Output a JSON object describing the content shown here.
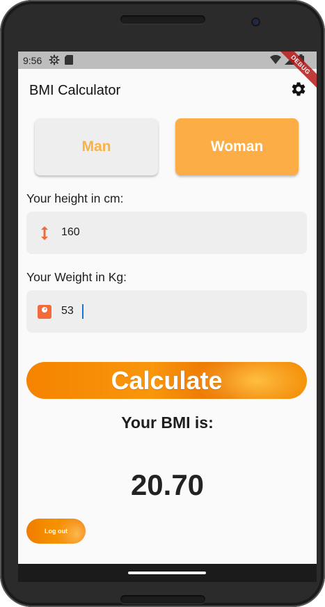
{
  "status_bar": {
    "time": "9:56",
    "debug_label": "DEBUG",
    "icons_left": [
      "settings-gear-icon",
      "sd-card-icon"
    ],
    "icons_right": [
      "wifi-icon",
      "signal-icon",
      "battery-icon"
    ]
  },
  "app_bar": {
    "title": "BMI Calculator",
    "settings_icon": "gear-icon"
  },
  "gender": {
    "man_label": "Man",
    "woman_label": "Woman",
    "selected": "Woman"
  },
  "height": {
    "label": "Your height in cm:",
    "value": "160",
    "icon": "height-arrows-icon"
  },
  "weight": {
    "label": "Your Weight in Kg:",
    "value": "53",
    "icon": "scale-icon"
  },
  "calculate_label": "Calculate",
  "result": {
    "label": "Your BMI is:",
    "value": "20.70"
  },
  "logout_label": "Log out",
  "colors": {
    "accent": "#fdad46",
    "man_text": "#f8b24a",
    "button_orange": "#f58300",
    "icon_orange": "#f26b3a"
  }
}
